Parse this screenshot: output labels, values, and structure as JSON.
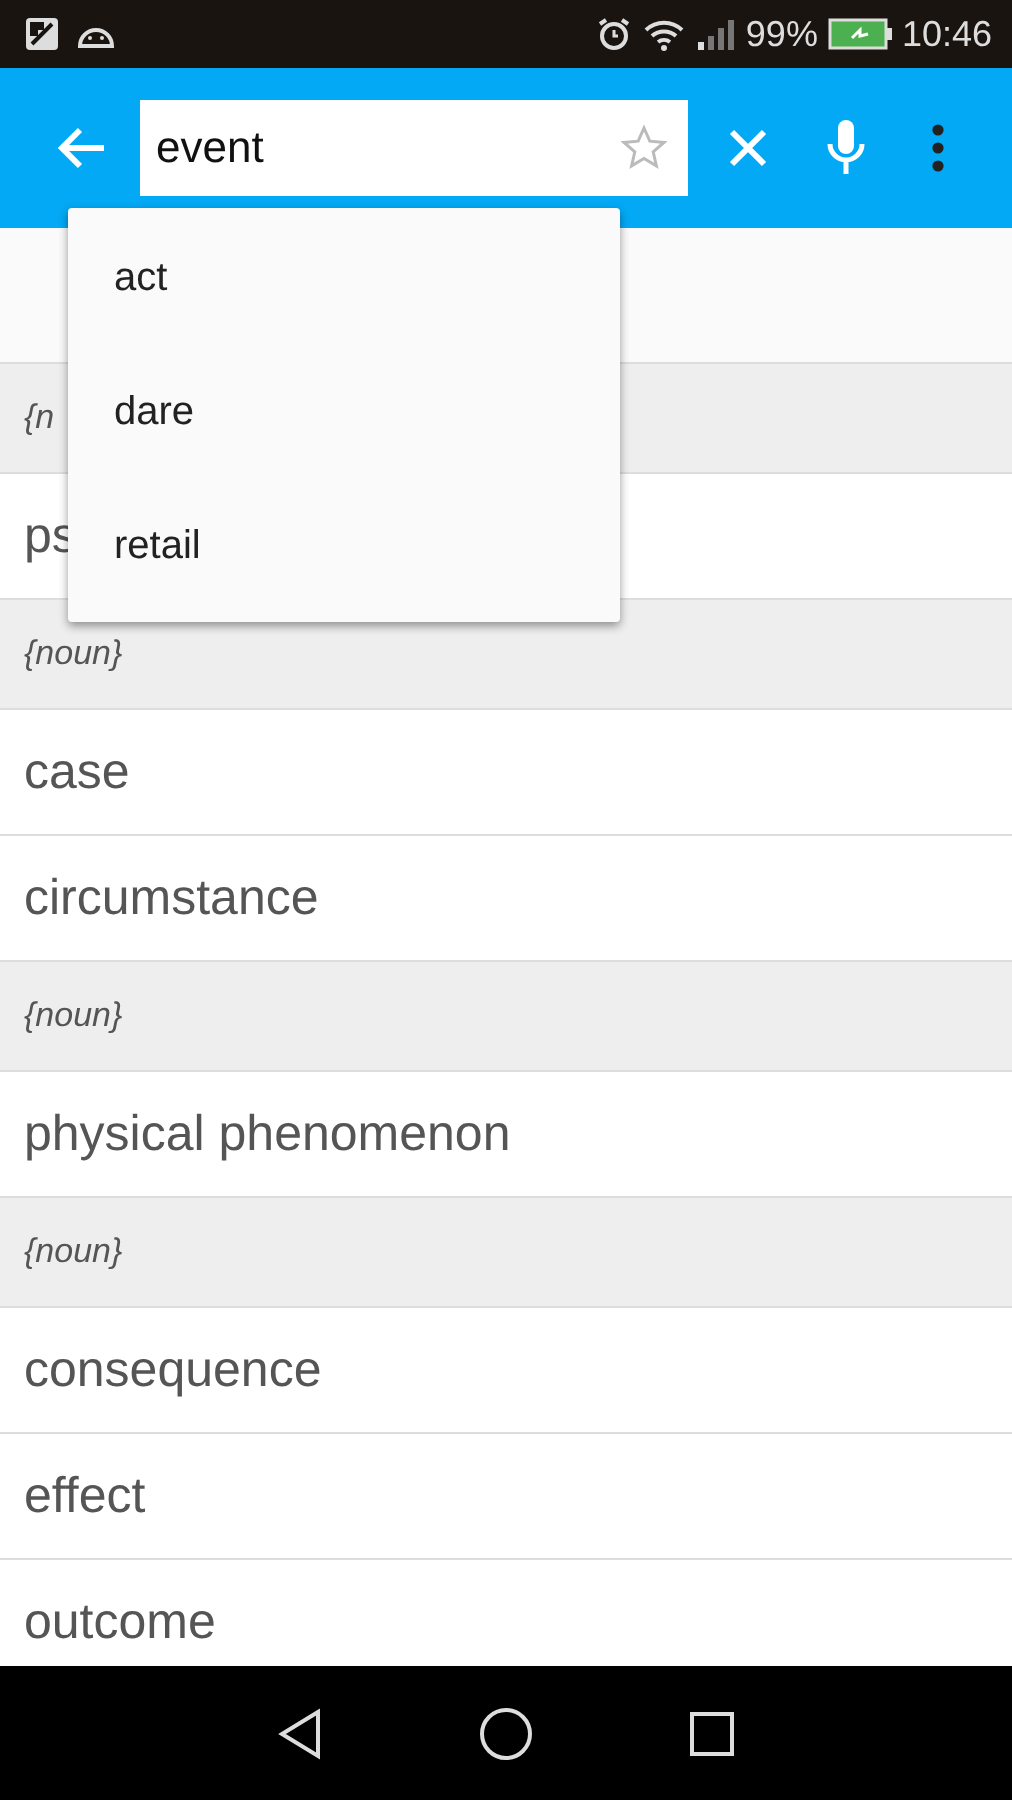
{
  "status_bar": {
    "battery": "99%",
    "time": "10:46"
  },
  "search": {
    "value": "event"
  },
  "suggestions": [
    {
      "label": "act"
    },
    {
      "label": "dare"
    },
    {
      "label": "retail"
    }
  ],
  "results": [
    {
      "kind": "header",
      "text": "{n"
    },
    {
      "kind": "word",
      "text": "ps"
    },
    {
      "kind": "header",
      "text": "{noun}"
    },
    {
      "kind": "word",
      "text": "case"
    },
    {
      "kind": "word",
      "text": "circumstance"
    },
    {
      "kind": "header",
      "text": "{noun}"
    },
    {
      "kind": "word",
      "text": "physical phenomenon"
    },
    {
      "kind": "header",
      "text": "{noun}"
    },
    {
      "kind": "word",
      "text": "consequence"
    },
    {
      "kind": "word",
      "text": "effect"
    },
    {
      "kind": "word",
      "text": "outcome"
    }
  ]
}
